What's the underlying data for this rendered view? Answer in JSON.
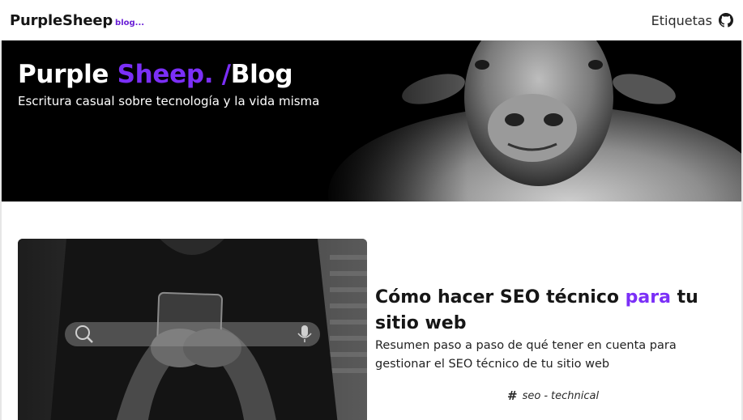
{
  "navbar": {
    "brand_name": "PurpleSheep",
    "brand_sub": "blog...",
    "tags_link": "Etiquetas",
    "github_icon": "github-icon"
  },
  "hero": {
    "title_part1": "Purple ",
    "title_accent": "Sheep. /",
    "title_part2": "Blog",
    "subtitle": "Escritura casual sobre tecnología y la vida misma",
    "image": "sheep-photo"
  },
  "post": {
    "image": "phone-search-photo",
    "title_part1": "Cómo hacer SEO técnico ",
    "title_accent": "para",
    "title_part2": " tu sitio web",
    "summary": "Resumen paso a paso de qué tener en cuenta para gestionar el SEO técnico de tu sitio web",
    "tag_icon": "hash-icon",
    "tags": [
      "seo",
      "technical"
    ],
    "tag_separator": "-"
  },
  "colors": {
    "accent": "#7b2ff7",
    "brand_sub": "#6a1fd6",
    "hero_bg": "#000000"
  }
}
